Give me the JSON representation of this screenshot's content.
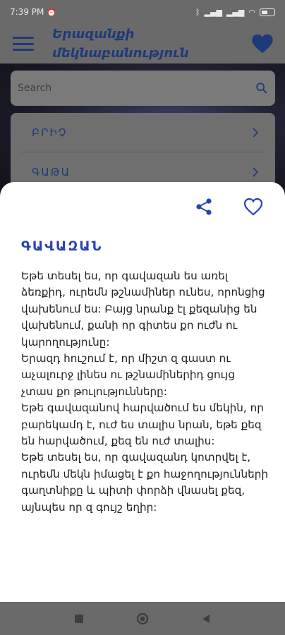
{
  "status_bar": {
    "time": "7:39 PM",
    "alarm_icon": "alarm-icon",
    "battery_icon": "battery-icon"
  },
  "app_bar": {
    "menu_icon": "hamburger-menu-icon",
    "title": "Երազանքի մեկնաբանություն",
    "favorite_icon": "heart-filled-icon",
    "accent_color": "#1f3a78"
  },
  "search": {
    "placeholder": "Search",
    "icon": "search-icon"
  },
  "list": {
    "items": [
      {
        "label": "ԲՐԻՉ"
      },
      {
        "label": "ԳԱԹԱ"
      }
    ]
  },
  "sheet": {
    "share_icon": "share-icon",
    "favorite_icon": "heart-outline-icon",
    "title": "ԳԱՎԱԶԱՆ",
    "title_color": "#2a43b0",
    "body": "Եթե տեսել ես, որ գավազան ես առել ձեռքիդ, ուրեմն թշնամիներ ունես, որոնցից վախենում ես: Բայց նրանք էլ քեզանից են վախենում, քանի որ գիտես քո ուժն ու կարողությունը:\nԵրազդ հուշում է, որ միշտ զ գաստ ու աչալուրջ լինես ու թշնամիներիդ ցույց չտաս քո թուլությունները:\nԵթե գավազանով հարվածում ես մեկին, որ բարեկամդ է, ուժ ես տալիս նրան, եթե քեզ են հարվածում, քեզ են ուժ տալիս:\nԵթե տեսել ես, որ գավազանդ կոտրվել է, ուրեմն մեկն իմացել է քո հաջողությունների գաղտնիքը և պիտի փորձի վնասել քեզ, այնպես որ զ գույշ եղիր:"
  },
  "nav_bar": {
    "recents_icon": "square-icon",
    "home_icon": "circle-icon",
    "back_icon": "triangle-back-icon"
  }
}
